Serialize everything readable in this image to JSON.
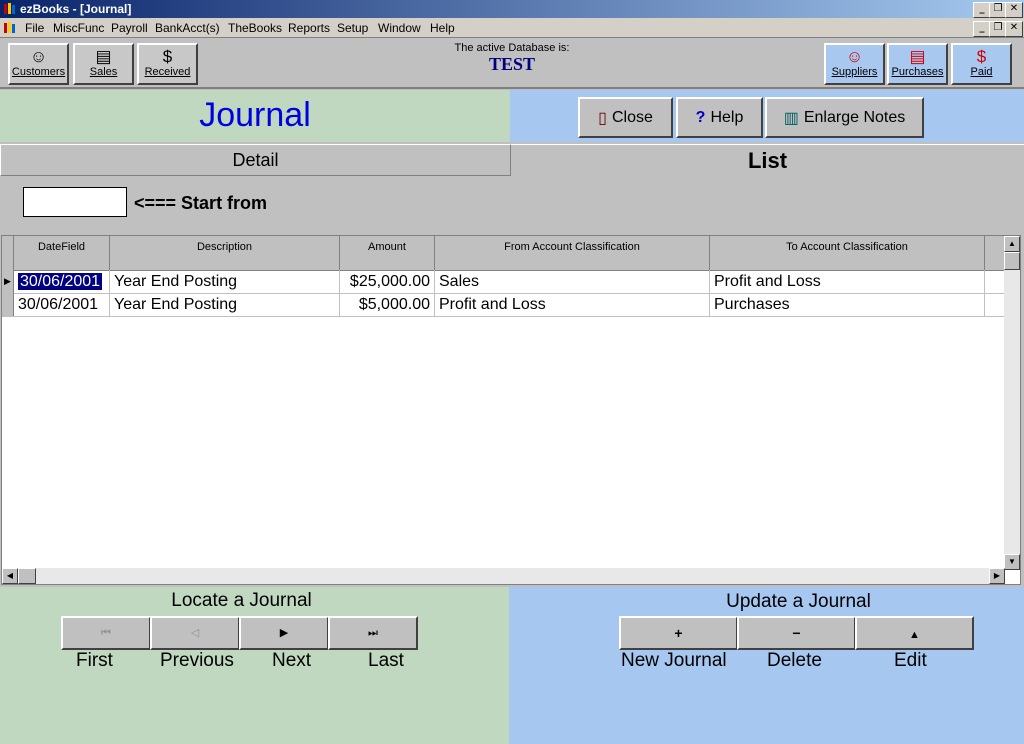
{
  "window": {
    "title": "ezBooks - [Journal]"
  },
  "menu": [
    {
      "label": "File",
      "key": "F"
    },
    {
      "label": "MiscFunc",
      "key": "M"
    },
    {
      "label": "Payroll",
      "key": "P"
    },
    {
      "label": "BankAcct(s)",
      "key": "B"
    },
    {
      "label": "TheBooks",
      "key": "T"
    },
    {
      "label": "Reports",
      "key": "R"
    },
    {
      "label": "Setup",
      "key": "S"
    },
    {
      "label": "Window",
      "key": "W"
    },
    {
      "label": "Help",
      "key": "H"
    }
  ],
  "toolbar": {
    "customers": "Customers",
    "sales": "Sales",
    "received": "Received",
    "suppliers": "Suppliers",
    "purchases": "Purchases",
    "paid": "Paid",
    "db_label": "The active Database is:",
    "db_name": "TEST"
  },
  "header": {
    "title": "Journal",
    "close": "Close",
    "help": "Help",
    "enlarge": "Enlarge Notes"
  },
  "tabs": {
    "detail": "Detail",
    "list": "List"
  },
  "start": {
    "value": "",
    "label": "<=== Start from"
  },
  "grid": {
    "columns": [
      "DateField",
      "Description",
      "Amount",
      "From Account Classification",
      "To Account Classification"
    ],
    "rows": [
      {
        "date": "30/06/2001",
        "description": "Year End Posting",
        "amount": "$25,000.00",
        "from": "Sales",
        "to": "Profit and Loss"
      },
      {
        "date": "30/06/2001",
        "description": "Year End Posting",
        "amount": "$5,000.00",
        "from": "Profit and Loss",
        "to": "Purchases"
      }
    ]
  },
  "locate": {
    "title": "Locate a Journal",
    "first": "First",
    "previous": "Previous",
    "next": "Next",
    "last": "Last"
  },
  "update": {
    "title": "Update a Journal",
    "new": "New Journal",
    "delete": "Delete",
    "edit": "Edit"
  },
  "colors": {
    "green_panel": "#c0d8c0",
    "blue_panel": "#a6c8f0",
    "title_blue": "#0000e0",
    "db_name": "#000080"
  }
}
